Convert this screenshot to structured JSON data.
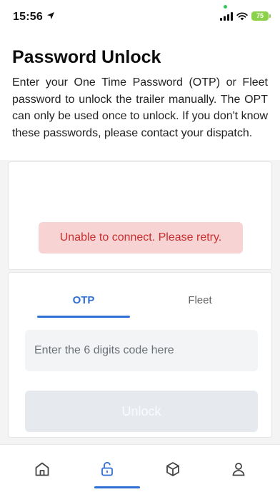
{
  "status_bar": {
    "time": "15:56",
    "battery": "75",
    "icons": [
      "location-arrow-icon",
      "signal-icon",
      "wifi-icon",
      "battery-icon"
    ]
  },
  "header": {
    "title": "Password Unlock",
    "description": "Enter your One Time Password (OTP) or Fleet password to unlock the trailer manually. The OPT can only be used once to unlock. If you don't know these passwords, please contact your dispatch."
  },
  "status_card": {
    "error_message": "Unable to connect. Please retry."
  },
  "form": {
    "tabs": [
      {
        "label": "OTP",
        "active": true
      },
      {
        "label": "Fleet",
        "active": false
      }
    ],
    "code_placeholder": "Enter the 6 digits code here",
    "unlock_label": "Unlock"
  },
  "bottom_nav": {
    "items": [
      "home-icon",
      "unlock-icon",
      "box-icon",
      "profile-icon"
    ],
    "active_index": 1
  },
  "colors": {
    "accent": "#2f6fd6",
    "error_bg": "#f7d3d3",
    "error_text": "#c92f2f",
    "battery": "#8cd14a"
  }
}
